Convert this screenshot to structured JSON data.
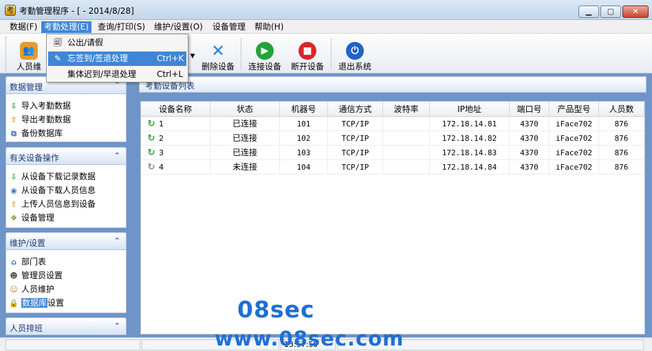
{
  "window": {
    "title": "考勤管理程序 - [ - 2014/8/28]"
  },
  "menubar": {
    "items": [
      "数据(F)",
      "考勤处理(E)",
      "查询/打印(S)",
      "维护/设置(O)",
      "设备管理",
      "帮助(H)"
    ]
  },
  "dropdown": {
    "items": [
      {
        "label": "公出/请假",
        "shortcut": "",
        "icon": "document-icon"
      },
      {
        "label": "忘签到/签退处理",
        "shortcut": "Ctrl+K",
        "icon": "user-edit-icon"
      },
      {
        "label": "集体迟到/早退处理",
        "shortcut": "Ctrl+L",
        "icon": ""
      }
    ]
  },
  "toolbar": {
    "first_label_partial": "人员维",
    "buttons": [
      {
        "label": "删除设备",
        "icon": "delete-x-icon",
        "color": "#2d7fd4"
      },
      {
        "label": "连接设备",
        "icon": "play-icon",
        "color": "#23a33a"
      },
      {
        "label": "断开设备",
        "icon": "stop-icon",
        "color": "#d9262b"
      },
      {
        "label": "退出系统",
        "icon": "power-icon",
        "color": "#1f63c8"
      }
    ]
  },
  "sidebar": {
    "sections": [
      {
        "title": "数据管理",
        "items": [
          {
            "label": "导入考勤数据",
            "icon": "arrow-down-icon"
          },
          {
            "label": "导出考勤数据",
            "icon": "arrow-up-icon"
          },
          {
            "label": "备份数据库",
            "icon": "backup-icon"
          }
        ]
      },
      {
        "title": "有关设备操作",
        "items": [
          {
            "label": "从设备下载记录数据",
            "icon": "arrow-down-icon"
          },
          {
            "label": "从设备下载人员信息",
            "icon": "globe-icon"
          },
          {
            "label": "上传人员信息到设备",
            "icon": "arrow-up-icon"
          },
          {
            "label": "设备管理",
            "icon": "device-manage-icon"
          }
        ]
      },
      {
        "title": "维护/设置",
        "items": [
          {
            "label": "部门表",
            "icon": "department-icon"
          },
          {
            "label": "管理员设置",
            "icon": "admin-icon"
          },
          {
            "label": "人员维护",
            "icon": "users-icon"
          },
          {
            "label_selected": "数据库",
            "label_rest": "设置",
            "icon": "lock-icon"
          }
        ]
      },
      {
        "title": "人员排班",
        "items": []
      }
    ]
  },
  "main": {
    "panel_title": "考勤设备列表",
    "columns": [
      "设备名称",
      "状态",
      "机器号",
      "通信方式",
      "波特率",
      "IP地址",
      "端口号",
      "产品型号",
      "人员数"
    ],
    "rows": [
      {
        "name": "1",
        "status": "已连接",
        "machine": "101",
        "comm": "TCP/IP",
        "baud": "",
        "ip": "172.18.14.81",
        "port": "4370",
        "model": "iFace702",
        "people": "876",
        "icon": "connected-icon"
      },
      {
        "name": "2",
        "status": "已连接",
        "machine": "102",
        "comm": "TCP/IP",
        "baud": "",
        "ip": "172.18.14.82",
        "port": "4370",
        "model": "iFace702",
        "people": "876",
        "icon": "connected-icon"
      },
      {
        "name": "3",
        "status": "已连接",
        "machine": "103",
        "comm": "TCP/IP",
        "baud": "",
        "ip": "172.18.14.83",
        "port": "4370",
        "model": "iFace702",
        "people": "876",
        "icon": "connected-icon"
      },
      {
        "name": "4",
        "status": "未连接",
        "machine": "104",
        "comm": "TCP/IP",
        "baud": "",
        "ip": "172.18.14.84",
        "port": "4370",
        "model": "iFace702",
        "people": "876",
        "icon": "disconnected-icon"
      }
    ]
  },
  "statusbar": {
    "time_partial": "13:57:59"
  },
  "watermark": {
    "line1": "08sec",
    "line2": "www.08sec.com"
  },
  "colors": {
    "accent": "#3f86d6",
    "panel_blue": "#6f94c8",
    "watermark": "#1f6fd3"
  }
}
